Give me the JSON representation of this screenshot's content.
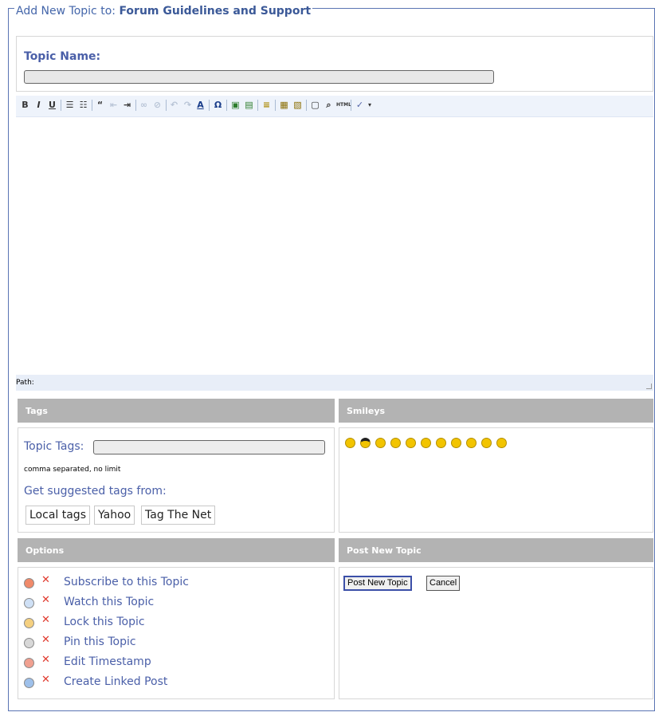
{
  "form": {
    "legend_prefix": "Add New Topic to:",
    "legend_forum": "Forum Guidelines and Support",
    "topic_name_label": "Topic Name:",
    "topic_name_value": ""
  },
  "editor": {
    "path_label": "Path:",
    "toolbar": [
      "bold-icon",
      "italic-icon",
      "underline-icon",
      "bullet-list-icon",
      "numbered-list-icon",
      "blockquote-icon",
      "outdent-icon",
      "indent-icon",
      "link-icon",
      "unlink-icon",
      "undo-icon",
      "redo-icon",
      "text-color-icon",
      "special-char-icon",
      "image-icon",
      "media-icon",
      "horizontal-rule-icon",
      "paste-word-icon",
      "paste-text-icon",
      "select-all-icon",
      "find-icon",
      "html-icon",
      "spellcheck-icon"
    ]
  },
  "tags": {
    "header": "Tags",
    "topic_tags_label": "Topic Tags:",
    "topic_tags_value": "",
    "hint": "comma separated, no limit",
    "suggest_label": "Get suggested tags from:",
    "sources": [
      "Local tags",
      "Yahoo",
      "Tag The Net"
    ]
  },
  "smileys": {
    "header": "Smileys",
    "items": [
      "confused-smiley-icon",
      "cool-smiley-icon",
      "sad-smiley-icon",
      "neutral-smiley-icon",
      "frown-smiley-icon",
      "surprised-smiley-icon",
      "grin-smiley-icon",
      "happy-smiley-icon",
      "shocked-smiley-icon",
      "wink-smiley-icon",
      "tongue-smiley-icon"
    ]
  },
  "options": {
    "header": "Options",
    "items": [
      {
        "label": "Subscribe to this Topic",
        "icon": "subscribe-icon"
      },
      {
        "label": "Watch this Topic",
        "icon": "watch-icon"
      },
      {
        "label": "Lock this Topic",
        "icon": "lock-icon"
      },
      {
        "label": "Pin this Topic",
        "icon": "pin-icon"
      },
      {
        "label": "Edit Timestamp",
        "icon": "timestamp-icon"
      },
      {
        "label": "Create Linked Post",
        "icon": "linked-post-icon"
      }
    ]
  },
  "post": {
    "header": "Post New Topic",
    "submit_label": "Post New Topic",
    "cancel_label": "Cancel"
  },
  "colors": {
    "accent": "#3b5998",
    "link": "#4a5fa8",
    "header_bg": "#b3b3b3",
    "toolbar_bg": "#eef3fb",
    "delete": "#e03a2e",
    "smiley": "#f2c400"
  }
}
